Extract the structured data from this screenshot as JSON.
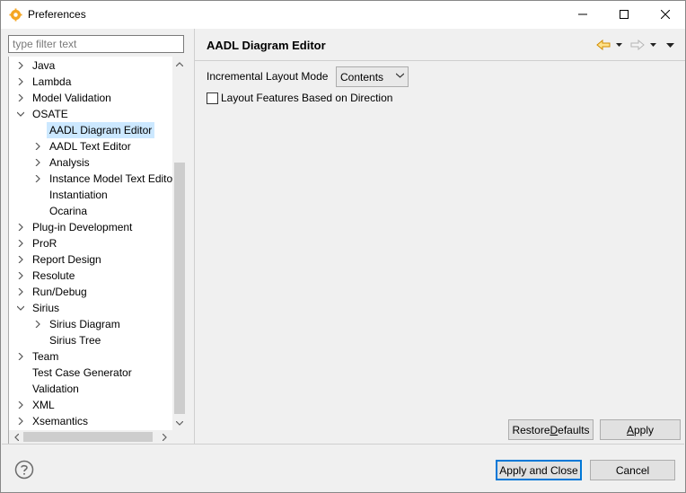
{
  "window": {
    "title": "Preferences",
    "icon": "eclipse-gear-icon",
    "controls": {
      "minimize": "minimize-icon",
      "maximize": "maximize-icon",
      "close": "close-icon"
    }
  },
  "filter": {
    "placeholder": "type filter text",
    "value": ""
  },
  "tree": {
    "items": [
      {
        "label": "Java",
        "expander": "collapsed",
        "selected": false
      },
      {
        "label": "Lambda",
        "expander": "collapsed",
        "selected": false
      },
      {
        "label": "Model Validation",
        "expander": "collapsed",
        "selected": false
      },
      {
        "label": "OSATE",
        "expander": "expanded",
        "selected": false
      },
      {
        "label": "AADL Diagram Editor",
        "expander": "none",
        "selected": true
      },
      {
        "label": "AADL Text Editor",
        "expander": "collapsed",
        "selected": false
      },
      {
        "label": "Analysis",
        "expander": "collapsed",
        "selected": false
      },
      {
        "label": "Instance Model Text Editor",
        "expander": "collapsed",
        "selected": false
      },
      {
        "label": "Instantiation",
        "expander": "none",
        "selected": false
      },
      {
        "label": "Ocarina",
        "expander": "none",
        "selected": false
      },
      {
        "label": "Plug-in Development",
        "expander": "collapsed",
        "selected": false
      },
      {
        "label": "ProR",
        "expander": "collapsed",
        "selected": false
      },
      {
        "label": "Report Design",
        "expander": "collapsed",
        "selected": false
      },
      {
        "label": "Resolute",
        "expander": "collapsed",
        "selected": false
      },
      {
        "label": "Run/Debug",
        "expander": "collapsed",
        "selected": false
      },
      {
        "label": "Sirius",
        "expander": "expanded",
        "selected": false
      },
      {
        "label": "Sirius Diagram",
        "expander": "collapsed",
        "selected": false
      },
      {
        "label": "Sirius Tree",
        "expander": "none",
        "selected": false
      },
      {
        "label": "Team",
        "expander": "collapsed",
        "selected": false
      },
      {
        "label": "Test Case Generator",
        "expander": "none",
        "selected": false
      },
      {
        "label": "Validation",
        "expander": "none",
        "selected": false
      },
      {
        "label": "XML",
        "expander": "collapsed",
        "selected": false
      },
      {
        "label": "Xsemantics",
        "expander": "collapsed",
        "selected": false
      }
    ]
  },
  "page": {
    "title": "AADL Diagram Editor",
    "nav": {
      "back": "back-arrow-icon",
      "back_menu": "back-dropdown-icon",
      "forward": "forward-arrow-icon",
      "forward_menu": "forward-dropdown-icon",
      "view_menu": "view-menu-icon"
    },
    "layout_mode_label": "Incremental Layout Mode",
    "layout_mode_value": "Contents",
    "features_checkbox_label": "Layout Features Based on Direction",
    "features_checked": false,
    "restore_defaults_pre": "Restore ",
    "restore_defaults_mnemonic": "D",
    "restore_defaults_post": "efaults",
    "apply_mnemonic": "A",
    "apply_post": "pply"
  },
  "footer": {
    "help_icon": "help-icon",
    "apply_close_label": "Apply and Close",
    "cancel_label": "Cancel"
  },
  "colors": {
    "selection": "#cce8ff",
    "default_button_border": "#0078d7",
    "nav_back_arrow": "#e8a000"
  }
}
